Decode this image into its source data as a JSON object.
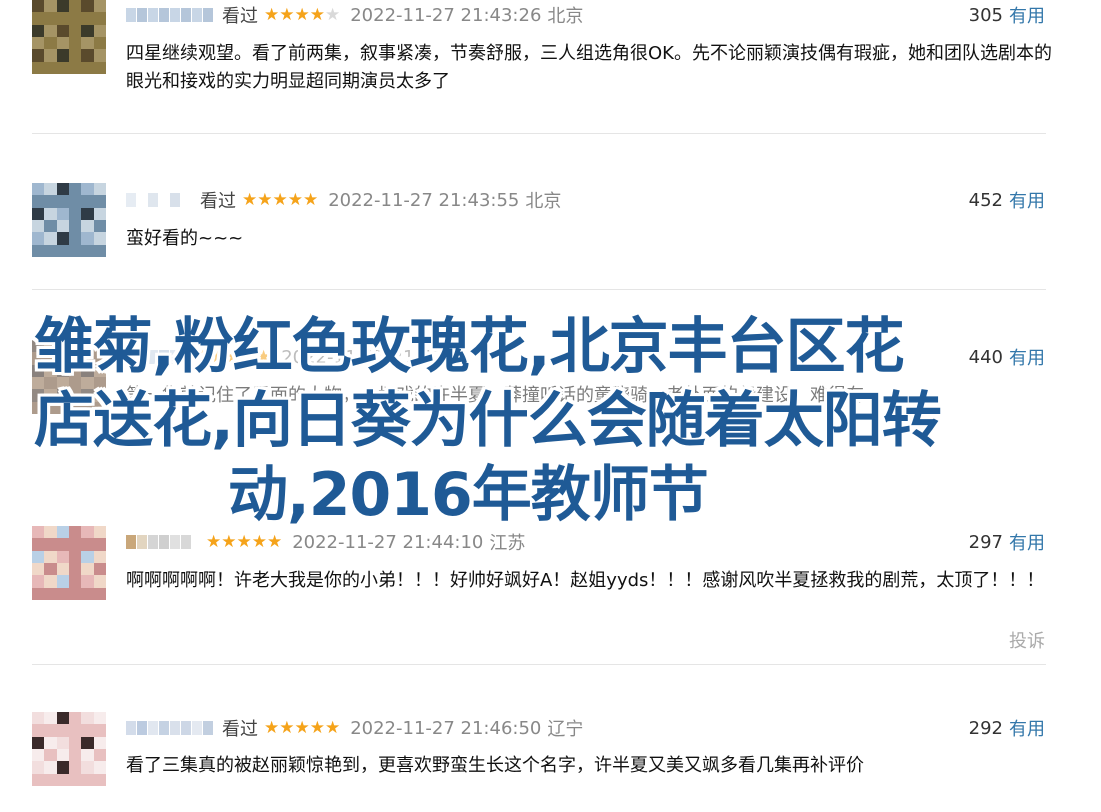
{
  "reviews": [
    {
      "seen": "看过",
      "stars": 4,
      "time": "2022-11-27 21:43:26",
      "location": "北京",
      "votes": "305",
      "useful": "有用",
      "content": "四星继续观望。看了前两集，叙事紧凑，节奏舒服，三人组选角很OK。先不论丽颖演技偶有瑕疵，她和团队选剧本的眼光和接戏的实力明显超同期演员太多了",
      "avatar_colors": [
        "#5a4a2c",
        "#8c7a45",
        "#3b3a2a",
        "#a59465"
      ]
    },
    {
      "seen": "看过",
      "stars": 5,
      "time": "2022-11-27 21:43:55",
      "location": "北京",
      "votes": "452",
      "useful": "有用",
      "content": "蛮好看的~~~",
      "avatar_colors": [
        "#9fb7cf",
        "#6f8da6",
        "#2f3b46",
        "#c7d5e0"
      ]
    },
    {
      "seen": "",
      "stars": 5,
      "time": "2022-11-27 21:43:",
      "location": "",
      "votes": "440",
      "useful": "有用",
      "content": "第一集就记住了里面的大物，一场戏的许半夏，莽撞听话的童骁骑，老外面的伊建设，难得有",
      "avatar_colors": [
        "#3a2a1f",
        "#6b4a30",
        "#2a1c14",
        "#8a6a4a"
      ]
    },
    {
      "seen": "",
      "stars": 5,
      "time": "2022-11-27 21:44:10",
      "location": "江苏",
      "votes": "297",
      "useful": "有用",
      "content": "啊啊啊啊啊！许老大我是你的小弟！！！好帅好飒好A！赵姐yyds！！！感谢风吹半夏拯救我的剧荒，太顶了！！！",
      "report": "投诉",
      "avatar_colors": [
        "#e7b8b8",
        "#c98c8c",
        "#b9d0e6",
        "#f0d8c8"
      ]
    },
    {
      "seen": "看过",
      "stars": 5,
      "time": "2022-11-27 21:46:50",
      "location": "辽宁",
      "votes": "292",
      "useful": "有用",
      "content": "看了三集真的被赵丽颖惊艳到，更喜欢野蛮生长这个名字，许半夏又美又飒多看几集再补评价",
      "avatar_colors": [
        "#f2dede",
        "#e8c0c0",
        "#3a2a2a",
        "#f7ecec"
      ]
    }
  ],
  "overlay": {
    "line1": "雏菊,粉红色玫瑰花,北京丰台区花",
    "line2": "店送花,向日葵为什么会随着太阳转",
    "line3": "动,2016年教师节"
  },
  "colors": {
    "star": "#f5a31a",
    "link": "#3377aa",
    "overlay": "#1f5a96"
  }
}
